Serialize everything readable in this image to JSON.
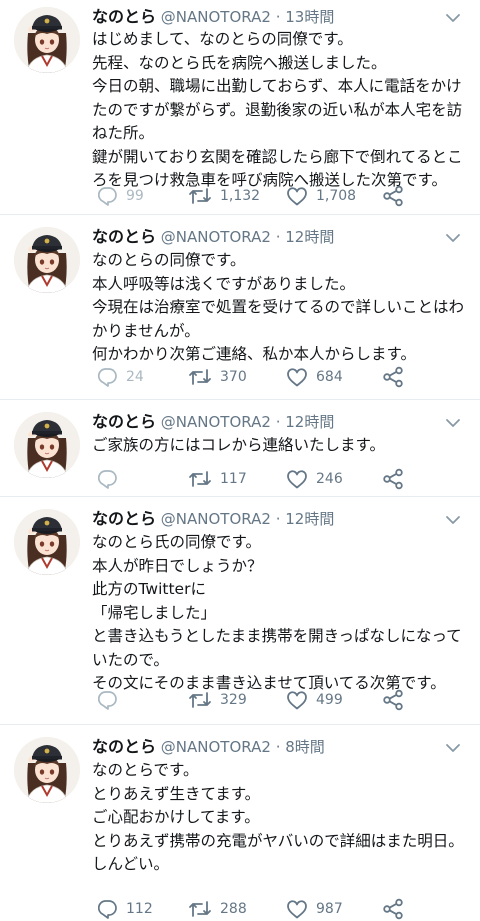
{
  "tweets": [
    {
      "name": "なのとら",
      "handle": "@NANOTORA2",
      "sep": "·",
      "time": "13時間",
      "text": "はじめまして、なのとらの同僚です。\n先程、なのとら氏を病院へ搬送しました。\n今日の朝、職場に出勤しておらず、本人に電話をかけたのですが繋がらず。退勤後家の近い私が本人宅を訪ねた所。\n鍵が開いており玄関を確認したら廊下で倒れてるところを見つけ救急車を呼び病院へ搬送した次第です。",
      "replies": "99",
      "retweets": "1,132",
      "likes": "1,708"
    },
    {
      "name": "なのとら",
      "handle": "@NANOTORA2",
      "sep": "·",
      "time": "12時間",
      "text": "なのとらの同僚です。\n本人呼吸等は浅くですがありました。\n今現在は治療室で処置を受けてるので詳しいことはわかりませんが。\n何かわかり次第ご連絡、私か本人からします。",
      "replies": "24",
      "retweets": "370",
      "likes": "684"
    },
    {
      "name": "なのとら",
      "handle": "@NANOTORA2",
      "sep": "·",
      "time": "12時間",
      "text": "ご家族の方にはコレから連絡いたします。",
      "replies": "",
      "retweets": "117",
      "likes": "246"
    },
    {
      "name": "なのとら",
      "handle": "@NANOTORA2",
      "sep": "·",
      "time": "12時間",
      "text": "なのとら氏の同僚です。\n本人が昨日でしょうか？\n此方のTwitterに\n「帰宅しました」\nと書き込もうとしたまま携帯を開きっぱなしになっていたので。\nその文にそのまま書き込ませて頂いてる次第です。",
      "replies": "",
      "retweets": "329",
      "likes": "499"
    },
    {
      "name": "なのとら",
      "handle": "@NANOTORA2",
      "sep": "·",
      "time": "8時間",
      "text": "なのとらです。\nとりあえず生きてます。\nご心配おかけしてます。\nとりあえず携帯の充電がヤバいので詳細はまた明日。\nしんどい。",
      "replies": "112",
      "retweets": "288",
      "likes": "987"
    }
  ],
  "icons": {
    "reply": "reply-icon",
    "retweet": "retweet-icon",
    "like": "heart-icon",
    "share": "share-icon",
    "menu": "chevron-down-icon",
    "avatar": "anime-girl-avatar"
  },
  "colors": {
    "text": "#14171a",
    "muted": "#657786",
    "divider": "#e6ecf0"
  }
}
